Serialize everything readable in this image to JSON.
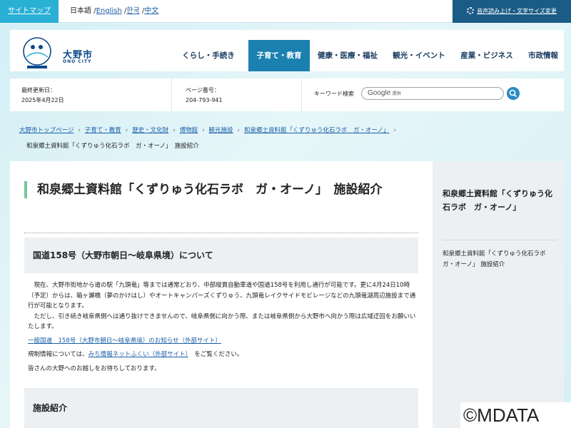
{
  "topbar": {
    "sitemap": "サイトマップ",
    "lang_current": "日本語",
    "lang_sep": "/",
    "languages": [
      "English",
      "한국",
      "中文"
    ],
    "voice": "音声読み上げ・文字サイズ変更"
  },
  "header": {
    "logo_name": "大野市",
    "logo_en": "ONO CITY",
    "nav": [
      "くらし・手続き",
      "子育て・教育",
      "健康・医療・福祉",
      "観光・イベント",
      "産業・ビジネス",
      "市政情報"
    ]
  },
  "info": {
    "updated_label": "最終更新日：",
    "updated_value": "2025年4月22日",
    "page_no_label": "ページ番号：",
    "page_no_value": "204-793-941",
    "search_label": "キーワード検索",
    "search_google": "Google",
    "search_provided": "提供"
  },
  "breadcrumb": {
    "items": [
      "大野市トップページ",
      "子育て・教育",
      "歴史・文化財",
      "博物館",
      "観光施設",
      "和泉郷土資料館「くずりゅう化石ラボ　ガ・オーノ」"
    ],
    "current": "和泉郷土資料館「くずりゅう化石ラボ　ガ・オーノ」　施設紹介"
  },
  "main": {
    "title": "和泉郷土資料館「くずりゅう化石ラボ　ガ・オーノ」　施設紹介",
    "notice_heading": "国道158号（大野市朝日～岐阜県境）について",
    "para1": "　現在、大野市街地から道の駅「九頭竜」等までは通常どおり、中部縦貫自動車道や国道158号を利用し通行が可能です。更に4月24日10時（予定）からは、箱ヶ瀬橋（夢のかけはし）やオートキャンパーズくずりゅう、九頭竜レイクサイドモビレージなどの九頭竜湖周辺施設まで通行が可能となります。",
    "para2": "　ただし、引き続き岐阜県側へは通り抜けできませんので、岐阜県側に向かう際、または岐阜県側から大野市へ向かう際は広域迂回をお願いいたします。",
    "link1": "一般国道　158号（大野市朝日～岐阜県境）のお知らせ（外部サイト）",
    "reg_prefix": "規制情報については、",
    "reg_link": "みち情報ネットふくい（外部サイト）",
    "reg_suffix": "をご覧ください。",
    "closing": "皆さんの大野へのお越しをお待ちしております。",
    "facility_heading": "施設紹介"
  },
  "sidebar": {
    "title": "和泉郷土資料館「くずりゅう化石ラボ　ガ・オーノ」",
    "item": "和泉郷土資料館「くずりゅう化石ラボ　ガ・オーノ」 施設紹介"
  },
  "watermark": "©MDATA",
  "colors": {
    "accent": "#1a80b0",
    "sitemap": "#29b0d4",
    "voice": "#1b5c86",
    "title_bar": "#74c69d"
  }
}
